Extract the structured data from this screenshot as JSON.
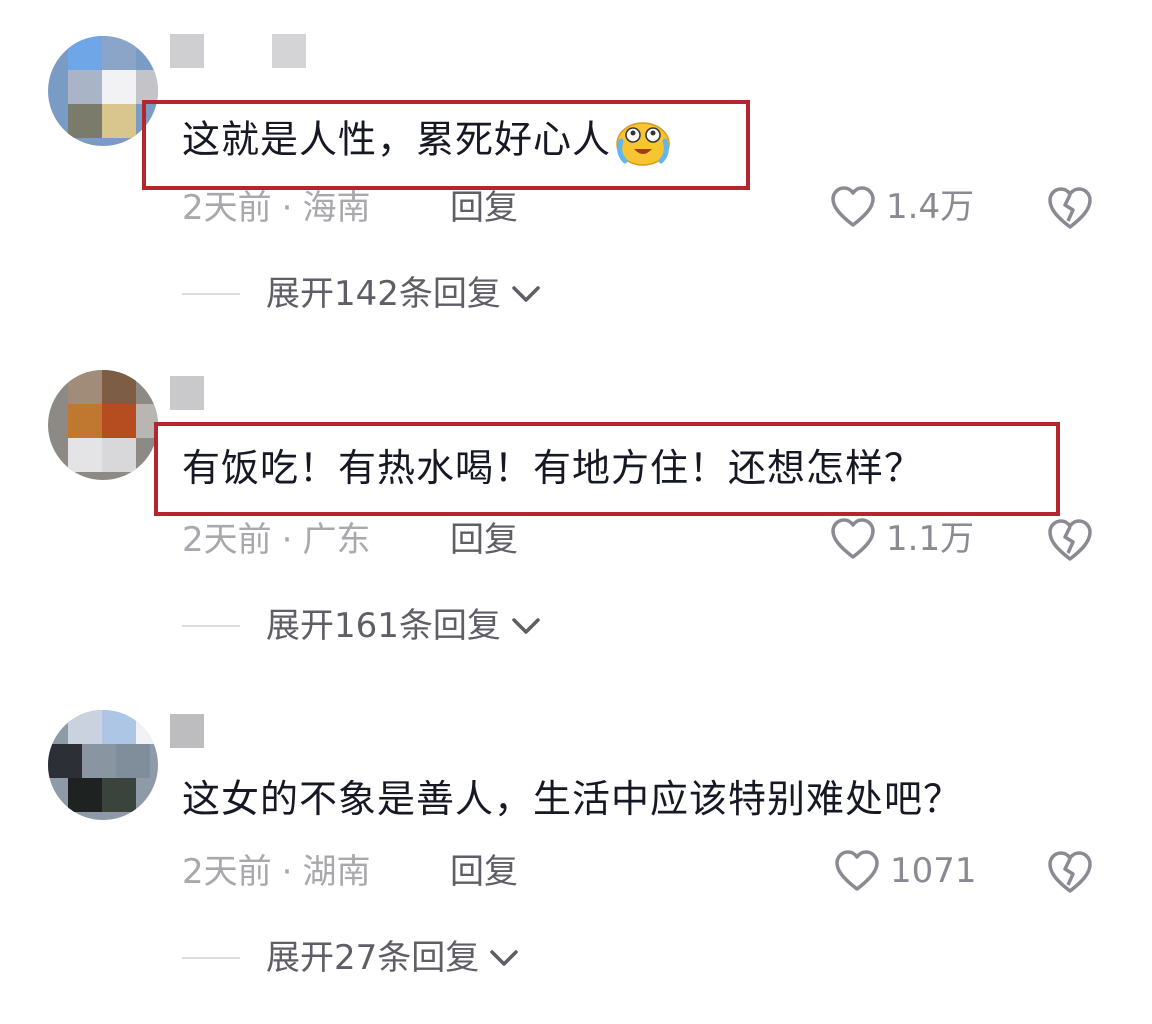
{
  "comments": [
    {
      "text": "这就是人性，累死好心人",
      "emoji": "laughing-crying-emoji",
      "time": "2天前",
      "separator": "·",
      "location": "海南",
      "reply": "回复",
      "likes": "1.4万",
      "expand": "展开142条回复",
      "highlighted": true
    },
    {
      "text": "有饭吃！有热水喝！有地方住！还想怎样？",
      "time": "2天前",
      "separator": "·",
      "location": "广东",
      "reply": "回复",
      "likes": "1.1万",
      "expand": "展开161条回复",
      "highlighted": true
    },
    {
      "text": "这女的不象是善人，生活中应该特别难处吧？",
      "time": "2天前",
      "separator": "·",
      "location": "湖南",
      "reply": "回复",
      "likes": "1071",
      "expand": "展开27条回复",
      "highlighted": false
    }
  ],
  "colors": {
    "highlight_box": "#b3262d",
    "text_primary": "#161823",
    "text_meta": "#a8a8ad",
    "text_secondary": "#5e5e66"
  },
  "icons": [
    "heart-outline-icon",
    "broken-heart-icon",
    "chevron-down-icon"
  ]
}
